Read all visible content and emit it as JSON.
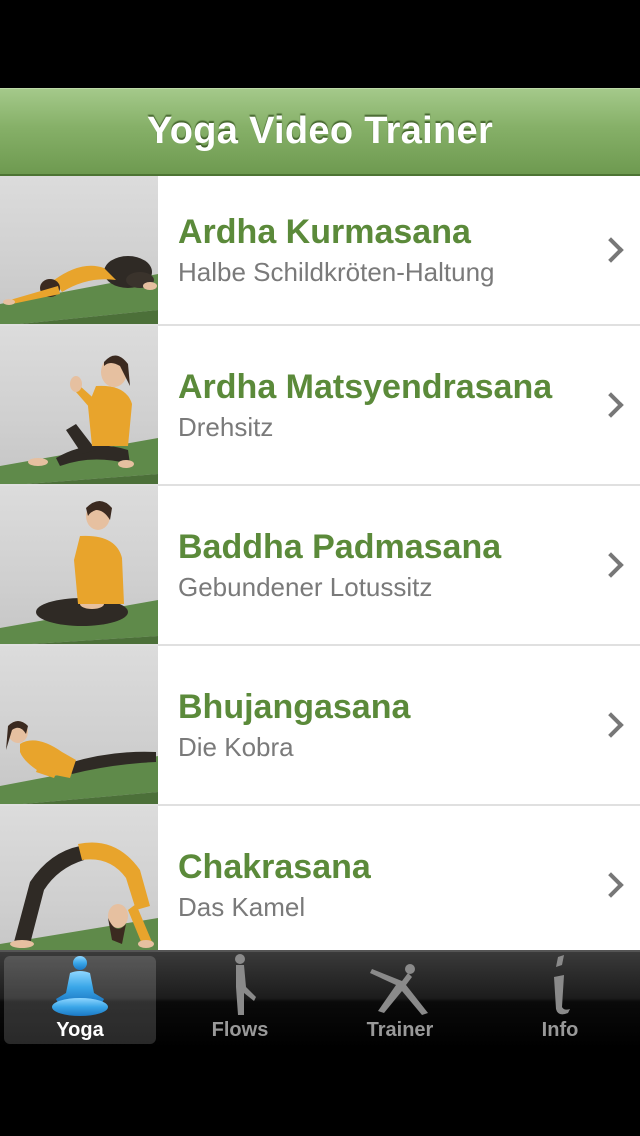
{
  "nav": {
    "title": "Yoga Video Trainer"
  },
  "poses": [
    {
      "title": "Ardha Kurmasana",
      "subtitle": "Halbe Schildkröten-Haltung"
    },
    {
      "title": "Ardha Matsyendrasana",
      "subtitle": "Drehsitz"
    },
    {
      "title": "Baddha Padmasana",
      "subtitle": "Gebundener Lotussitz"
    },
    {
      "title": "Bhujangasana",
      "subtitle": "Die Kobra"
    },
    {
      "title": "Chakrasana",
      "subtitle": "Das Kamel"
    }
  ],
  "tabs": [
    {
      "label": "Yoga",
      "icon": "meditation-icon",
      "selected": true
    },
    {
      "label": "Flows",
      "icon": "standing-pose-icon",
      "selected": false
    },
    {
      "label": "Trainer",
      "icon": "downward-dog-icon",
      "selected": false
    },
    {
      "label": "Info",
      "icon": "info-icon",
      "selected": false
    }
  ],
  "colors": {
    "nav_green": "#86b068",
    "title_green": "#5b8a3a",
    "subtitle_gray": "#7a7a7a",
    "selected_tab_blue": "#3aa6e8",
    "shirt_yellow": "#e8a42c",
    "mat_green": "#5f8a4a"
  }
}
